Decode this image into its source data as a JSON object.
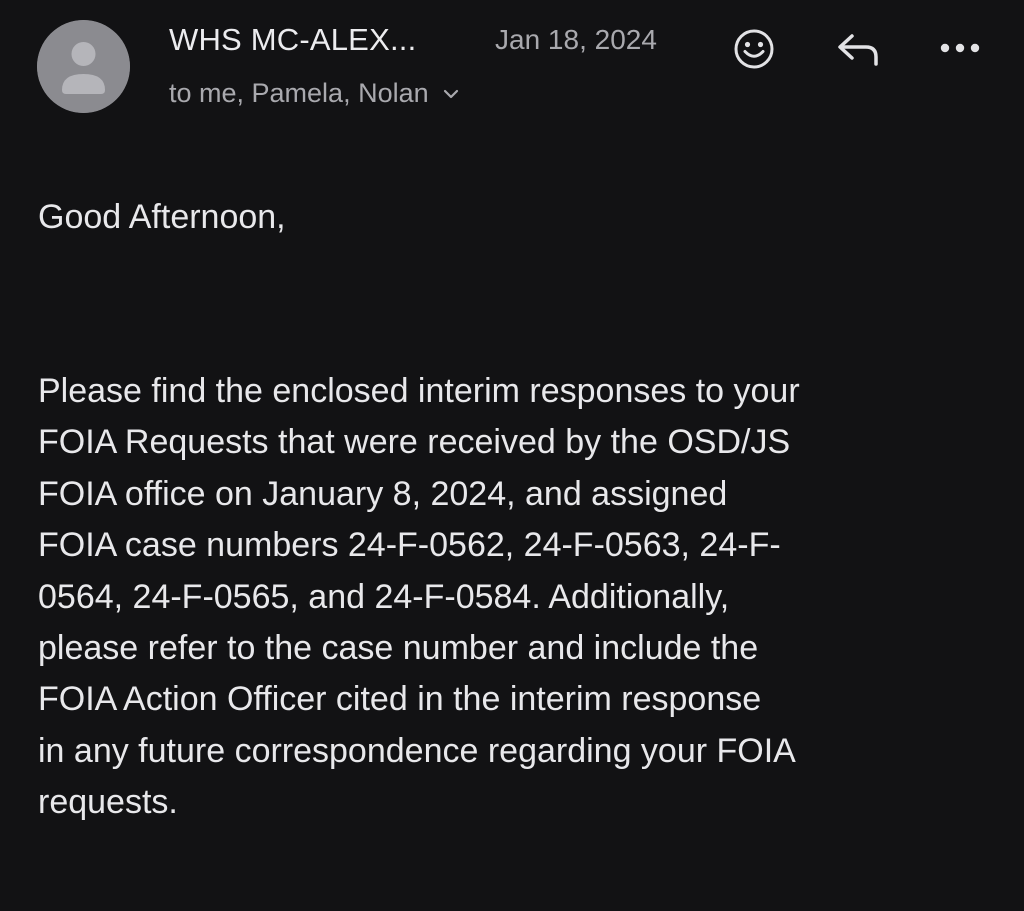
{
  "header": {
    "sender": "WHS MC-ALEX...",
    "date": "Jan 18, 2024",
    "recipients": "to me, Pamela, Nolan",
    "icons": {
      "avatar": "person-avatar-icon",
      "emoji": "emoji-reaction-icon",
      "reply": "reply-arrow-icon",
      "more": "more-options-icon",
      "expand": "chevron-down-icon"
    }
  },
  "message": {
    "greeting": "Good Afternoon,",
    "body": "Please find the enclosed interim responses to your\nFOIA Requests that were received by the OSD/JS\nFOIA office on January 8, 2024, and assigned\nFOIA case numbers 24-F-0562, 24-F-0563, 24-F-\n0564, 24-F-0565, and 24-F-0584.  Additionally,\nplease refer to the case number and include the\nFOIA Action Officer cited in the interim response\nin any future correspondence regarding your FOIA\nrequests."
  },
  "colors": {
    "background": "#121214",
    "primary_text": "#e8e8eb",
    "secondary_text": "#a9a9ae",
    "avatar": "#8b8b90"
  }
}
